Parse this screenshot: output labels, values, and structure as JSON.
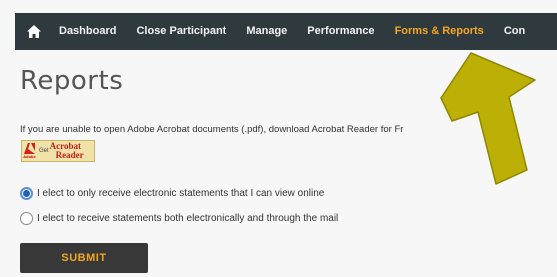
{
  "nav": {
    "home_icon": "home-icon",
    "items": [
      "Dashboard",
      "Close Participant",
      "Manage",
      "Performance",
      "Forms & Reports",
      "Con"
    ],
    "active_index": 4
  },
  "page": {
    "title": "Reports",
    "info_text": "If you are unable to open Adobe Acrobat documents (.pdf), download Acrobat Reader for Fr",
    "acrobat_badge": {
      "logo_text": "Adobe",
      "get": "Get",
      "line1": "Acrobat",
      "line2": "Reader"
    }
  },
  "statements": {
    "options": [
      {
        "label": "I elect to only receive electronic statements that I can view online",
        "checked": true
      },
      {
        "label": "I elect to receive statements both electronically and through the mail",
        "checked": false
      }
    ],
    "submit_label": "SUBMIT"
  },
  "colors": {
    "nav_bg": "#2f3a3f",
    "active": "#f4a623",
    "annotation_arrow": "#bcb007"
  }
}
